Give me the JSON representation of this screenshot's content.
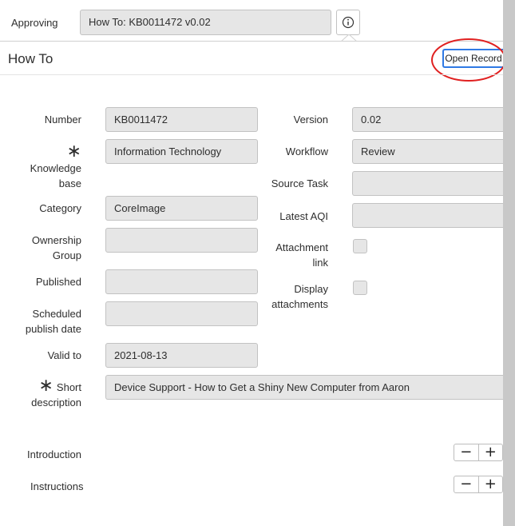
{
  "approval_bar": {
    "label": "Approving",
    "record_value": "How To: KB0011472 v0.02",
    "info_icon": "info-icon"
  },
  "header": {
    "title": "How To",
    "open_record_label": "Open Record"
  },
  "form": {
    "number_label": "Number",
    "number_value": "KB0011472",
    "knowledge_base_label_1": "Knowledge",
    "knowledge_base_label_2": "base",
    "knowledge_base_value": "Information Technology",
    "category_label": "Category",
    "category_value": "CoreImage",
    "ownership_group_label_1": "Ownership",
    "ownership_group_label_2": "Group",
    "ownership_group_value": "",
    "published_label": "Published",
    "published_value": "",
    "scheduled_label_1": "Scheduled",
    "scheduled_label_2": "publish date",
    "scheduled_value": "",
    "valid_to_label": "Valid to",
    "valid_to_value": "2021-08-13",
    "short_desc_label_1": "Short",
    "short_desc_label_2": "description",
    "short_desc_value": "Device Support - How to Get a Shiny New Computer from Aaron",
    "version_label": "Version",
    "version_value": "0.02",
    "workflow_label": "Workflow",
    "workflow_value": "Review",
    "source_task_label": "Source Task",
    "source_task_value": "",
    "latest_aqi_label": "Latest AQI",
    "latest_aqi_value": "",
    "attachment_link_label_1": "Attachment",
    "attachment_link_label_2": "link",
    "display_attachments_label_1": "Display",
    "display_attachments_label_2": "attachments",
    "required_marker": "∗"
  },
  "sections": {
    "introduction_label": "Introduction",
    "instructions_label": "Instructions",
    "minus": "−",
    "plus": "+"
  },
  "colors": {
    "field_bg": "#e6e6e6",
    "focus_blue": "#2f7ae5",
    "annotation_red": "#e02020",
    "scrollbar": "#c8c8c8"
  }
}
